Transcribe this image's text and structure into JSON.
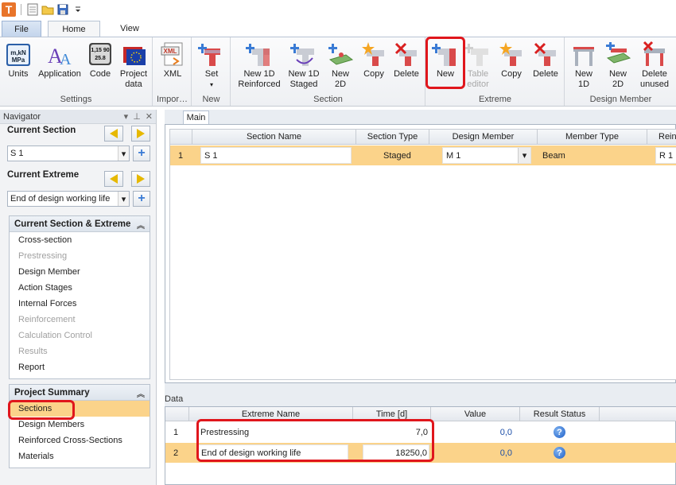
{
  "tabs": {
    "file": "File",
    "home": "Home",
    "view": "View"
  },
  "ribbon": {
    "groups": {
      "settings": "Settings",
      "import": "Impor…",
      "new": "New",
      "section": "Section",
      "extreme": "Extreme",
      "design_member": "Design Member"
    },
    "units": "Units",
    "application": "Application",
    "code": "Code",
    "project_data_1": "Project",
    "project_data_2": "data",
    "xml": "XML",
    "set": "Set",
    "new_1d_reinforced_1": "New 1D",
    "new_1d_reinforced_2": "Reinforced",
    "new_1d_staged_1": "New 1D",
    "new_1d_staged_2": "Staged",
    "new_2d_1": "New",
    "new_2d_2": "2D",
    "section_copy": "Copy",
    "section_delete": "Delete",
    "extreme_new": "New",
    "table_editor_1": "Table",
    "table_editor_2": "editor",
    "extreme_copy": "Copy",
    "extreme_delete": "Delete",
    "dm_new_1d_1": "New",
    "dm_new_1d_2": "1D",
    "dm_new_2d_1": "New",
    "dm_new_2d_2": "2D",
    "dm_delete_unused_1": "Delete",
    "dm_delete_unused_2": "unused",
    "units_icon_text": "kN MPa",
    "code_icon_text": "1,15 90 25.8"
  },
  "navigator": {
    "title": "Navigator",
    "current_section_label": "Current Section",
    "current_section_value": "S 1",
    "current_extreme_label": "Current Extreme",
    "current_extreme_value": "End of design working life",
    "section_extreme_panel": {
      "title": "Current Section & Extreme",
      "items": [
        {
          "label": "Cross-section"
        },
        {
          "label": "Prestressing"
        },
        {
          "label": "Design Member"
        },
        {
          "label": "Action Stages"
        },
        {
          "label": "Internal Forces"
        },
        {
          "label": "Reinforcement"
        },
        {
          "label": "Calculation Control"
        },
        {
          "label": "Results"
        },
        {
          "label": "Report"
        }
      ]
    },
    "project_summary_panel": {
      "title": "Project Summary",
      "items": [
        {
          "label": "Sections"
        },
        {
          "label": "Design Members"
        },
        {
          "label": "Reinforced Cross-Sections"
        },
        {
          "label": "Materials"
        }
      ]
    }
  },
  "main": {
    "tab": "Main",
    "columns": [
      "Section Name",
      "Section Type",
      "Design Member",
      "Member Type",
      "Rein"
    ],
    "rows": [
      {
        "index": "1",
        "section_name": "S 1",
        "section_type": "Staged",
        "design_member": "M 1",
        "member_type": "Beam",
        "rein": "R 1"
      }
    ]
  },
  "data_panel": {
    "label": "Data",
    "columns": [
      "Extreme Name",
      "Time [d]",
      "Value",
      "Result Status"
    ],
    "rows": [
      {
        "index": "1",
        "extreme_name": "Prestressing",
        "time": "7,0",
        "value": "0,0"
      },
      {
        "index": "2",
        "extreme_name": "End of design working life",
        "time": "18250,0",
        "value": "0,0"
      }
    ]
  }
}
